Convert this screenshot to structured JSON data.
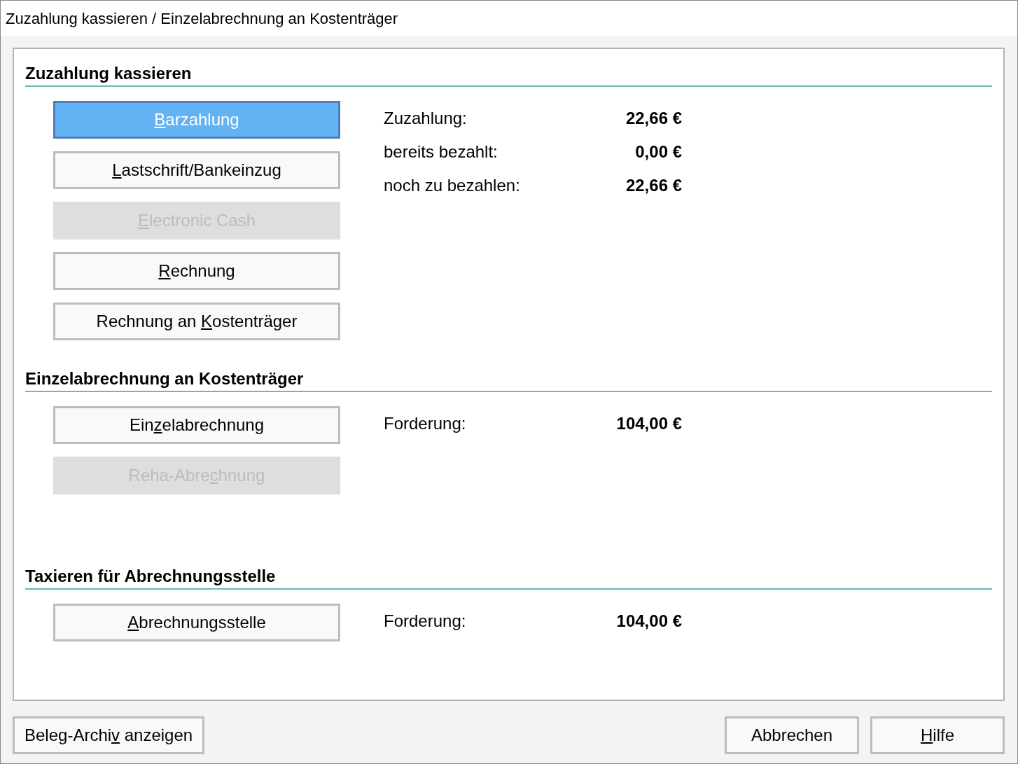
{
  "window": {
    "title": "Zuzahlung kassieren / Einzelabrechnung an Kostenträger"
  },
  "sections": [
    {
      "heading": "Zuzahlung kassieren",
      "buttons": [
        {
          "label": {
            "key": "B",
            "after": "arzahlung"
          },
          "default": true,
          "disabled": false
        },
        {
          "label": {
            "key": "L",
            "after": "astschrift/Bankeinzug"
          },
          "default": false,
          "disabled": false
        },
        {
          "label": {
            "key": "E",
            "after": "lectronic Cash"
          },
          "default": false,
          "disabled": true
        },
        {
          "label": {
            "key": "R",
            "after": "echnung"
          },
          "default": false,
          "disabled": false
        },
        {
          "label": {
            "before": "Rechnung an ",
            "key": "K",
            "after": "ostenträger"
          },
          "default": false,
          "disabled": false
        }
      ],
      "amounts": [
        {
          "label": "Zuzahlung:",
          "value": "22,66 €"
        },
        {
          "label": "bereits bezahlt:",
          "value": "0,00 €"
        },
        {
          "label": "noch zu bezahlen:",
          "value": "22,66 €"
        }
      ]
    },
    {
      "heading": "Einzelabrechnung an Kostenträger",
      "buttons": [
        {
          "label": {
            "before": "Ein",
            "key": "z",
            "after": "elabrechnung"
          },
          "default": false,
          "disabled": false
        },
        {
          "label": {
            "before": "Reha-Abre",
            "key": "c",
            "after": "hnung"
          },
          "default": false,
          "disabled": true
        }
      ],
      "amounts": [
        {
          "label": "Forderung:",
          "value": "104,00 €"
        }
      ]
    },
    {
      "heading": "Taxieren für Abrechnungsstelle",
      "buttons": [
        {
          "label": {
            "key": "A",
            "after": "brechnungsstelle"
          },
          "default": false,
          "disabled": false
        }
      ],
      "amounts": [
        {
          "label": "Forderung:",
          "value": "104,00 €"
        }
      ]
    }
  ],
  "footer": {
    "left_buttons": [
      {
        "label": {
          "before": "Beleg-Archi",
          "key": "v",
          "after": " anzeigen"
        }
      }
    ],
    "right_buttons": [
      {
        "label": {
          "before": "Abbrechen"
        }
      },
      {
        "label": {
          "key": "H",
          "after": "ilfe"
        }
      }
    ]
  }
}
